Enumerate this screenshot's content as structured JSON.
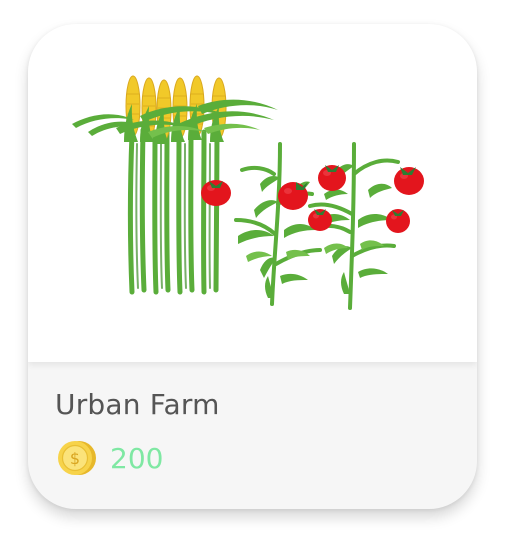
{
  "item": {
    "title": "Urban Farm",
    "price": "200",
    "currency_icon": "gold-coin-icon",
    "illustration": "corn-and-tomato-plants"
  },
  "colors": {
    "price": "#7fe8a3",
    "title": "#555555",
    "coin_gold": "#f7d34a",
    "stalk_green": "#5aad3a",
    "corn_yellow": "#f1c929",
    "tomato_red": "#e3151d",
    "card_bottom": "#f6f6f6"
  }
}
